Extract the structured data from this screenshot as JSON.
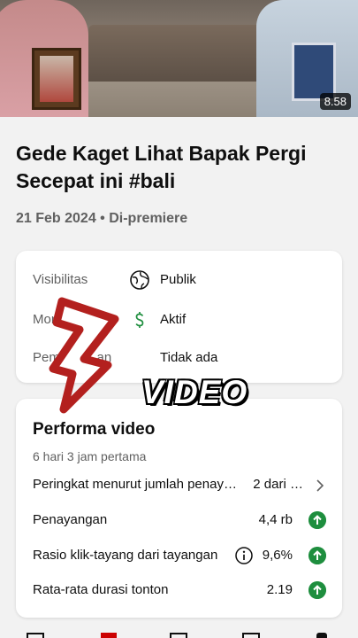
{
  "video": {
    "duration": "8.58",
    "title": "Gede Kaget Lihat Bapak Pergi Secepat ini #bali",
    "meta": "21 Feb 2024 • Di-premiere"
  },
  "details": {
    "visibility_label": "Visibilitas",
    "visibility_value": "Publik",
    "monetization_label": "Mon",
    "monetization_value": "Aktif",
    "restriction_label": "Pem          an",
    "restriction_value": "Tidak ada"
  },
  "overlay": {
    "text": "VIDEO",
    "arrow_color": "#b3201e"
  },
  "performance": {
    "title": "Performa video",
    "subtitle": "6 hari 3 jam pertama",
    "rows": [
      {
        "label": "Peringkat menurut jumlah penay…",
        "value": "2 dari …",
        "indicator": "chevron"
      },
      {
        "label": "Penayangan",
        "value": "4,4 rb",
        "indicator": "up-arrow"
      },
      {
        "label": "Rasio klik-tayang dari tayangan",
        "value": "9,6%",
        "indicator": "up-arrow",
        "info": true
      },
      {
        "label": "Rata-rata durasi tonton",
        "value": "2.19",
        "indicator": "up-arrow"
      }
    ]
  },
  "colors": {
    "accent_green": "#1e8e3e",
    "text_secondary": "#606060",
    "nav_red": "#cc0000"
  }
}
